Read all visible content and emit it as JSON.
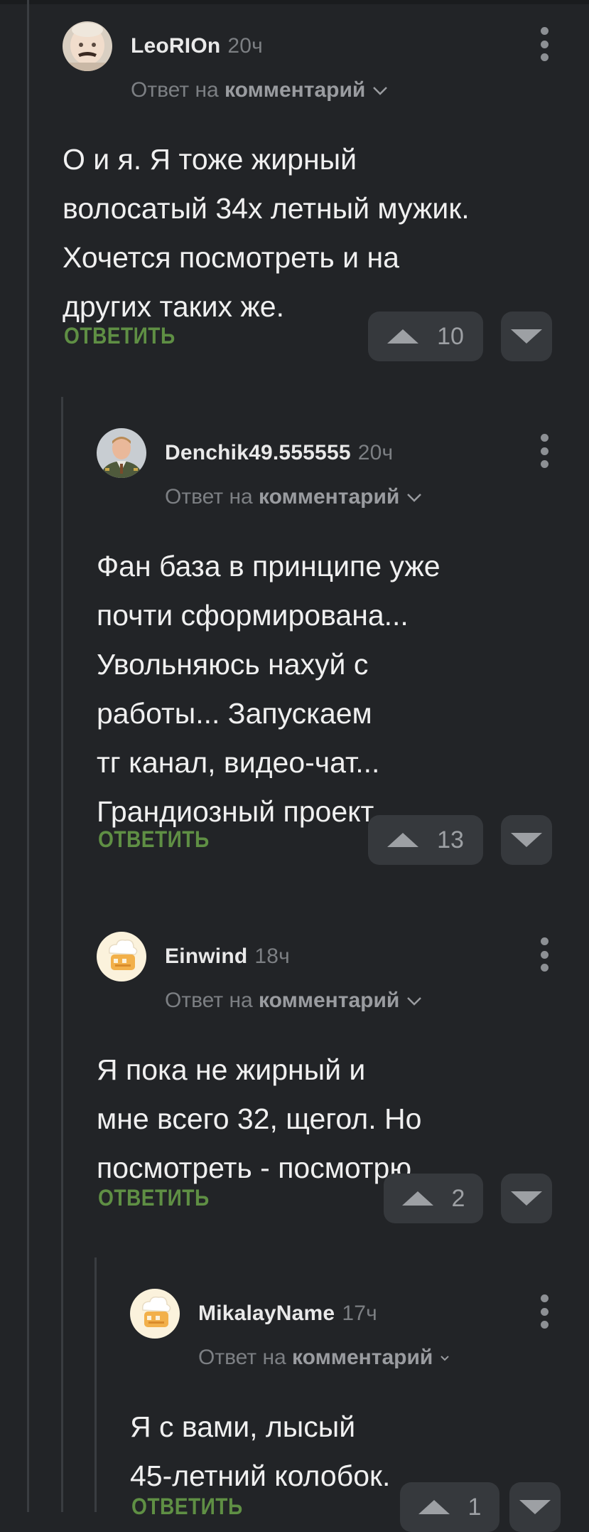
{
  "comments": [
    {
      "username": "LeoRIOn",
      "time": "20ч",
      "reply_prefix": "Ответ на",
      "reply_target": "комментарий",
      "lines": [
        "О и я. Я тоже жирный",
        "волосатый 34х летный мужик.",
        "Хочется посмотреть и на",
        "других таких же."
      ],
      "reply_label": "ОТВЕТИТЬ",
      "rating": "10",
      "avatar_icon": "baby-avatar-icon"
    },
    {
      "username": "Denchik49.555555",
      "time": "20ч",
      "reply_prefix": "Ответ на",
      "reply_target": "комментарий",
      "lines": [
        "Фан база в принципе уже",
        "почти сформирована...",
        "Увольняюсь нахуй с",
        "работы... Запускаем",
        "тг канал, видео-чат...",
        "Грандиозный проект..."
      ],
      "reply_label": "ОТВЕТИТЬ",
      "rating": "13",
      "avatar_icon": "man-in-uniform-avatar-icon"
    },
    {
      "username": "Einwind",
      "time": "18ч",
      "reply_prefix": "Ответ на",
      "reply_target": "комментарий",
      "lines": [
        "Я пока не жирный и",
        "мне всего 32, щегол. Но",
        "посмотреть - посмотрю."
      ],
      "reply_label": "ОТВЕТИТЬ",
      "rating": "2",
      "avatar_icon": "default-avatar-icon"
    },
    {
      "username": "MikalayName",
      "time": "17ч",
      "reply_prefix": "Ответ на",
      "reply_target": "комментарий",
      "lines": [
        "Я с вами, лысый",
        "45-летний колобок."
      ],
      "reply_label": "ОТВЕТИТЬ",
      "rating": "1",
      "avatar_icon": "default-avatar-icon"
    }
  ],
  "colors": {
    "background": "#222427",
    "accent_reply": "#5f8f44",
    "vote_button": "#36393d"
  }
}
